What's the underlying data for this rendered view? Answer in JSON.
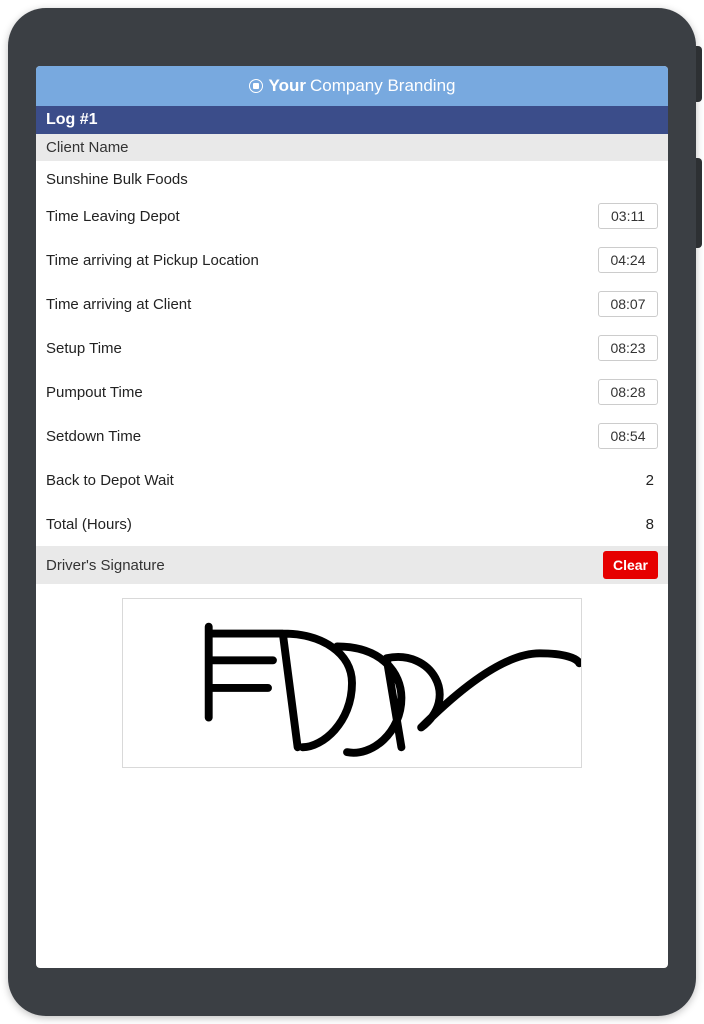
{
  "brand": {
    "bold": "Your",
    "rest": "Company Branding"
  },
  "log": {
    "title": "Log #1",
    "client_name_label": "Client Name",
    "client_name_value": "Sunshine Bulk Foods",
    "rows": [
      {
        "label": "Time Leaving Depot",
        "value": "03:11",
        "input": true
      },
      {
        "label": "Time arriving at Pickup Location",
        "value": "04:24",
        "input": true
      },
      {
        "label": "Time arriving at Client",
        "value": "08:07",
        "input": true
      },
      {
        "label": "Setup Time",
        "value": "08:23",
        "input": true
      },
      {
        "label": "Pumpout Time",
        "value": "08:28",
        "input": true
      },
      {
        "label": "Setdown Time",
        "value": "08:54",
        "input": true
      },
      {
        "label": "Back to Depot Wait",
        "value": "2",
        "input": false
      },
      {
        "label": "Total (Hours)",
        "value": "8",
        "input": false
      }
    ],
    "signature_label": "Driver's Signature",
    "clear_label": "Clear"
  }
}
